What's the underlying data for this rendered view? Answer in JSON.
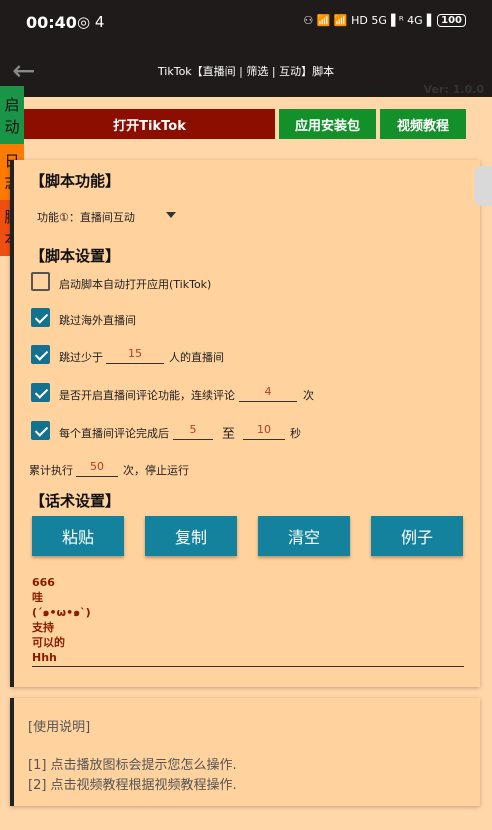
{
  "status": {
    "time": "00:40",
    "notif": "4",
    "net_icons": "⚇ 📶 📶 HD 5G▐ ᴿ 4G▐",
    "battery": "100"
  },
  "toolbar": {
    "title": "TikTok【直播间 | 筛选 | 互动】脚本"
  },
  "version": "Ver: 1.0.0",
  "sidetabs": {
    "start": "启\n动",
    "log": "日\n志",
    "script": "脚\n本"
  },
  "buttons": {
    "open": "打开TikTok",
    "install": "应用安装包",
    "video": "视频教程"
  },
  "sections": {
    "func": "【脚本功能】",
    "settings": "【脚本设置】",
    "talk": "【话术设置】"
  },
  "function": {
    "label": "功能①：直播间互动"
  },
  "settings": {
    "auto_open": "启动脚本自动打开应用(TikTok)",
    "skip_overseas": "跳过海外直播间",
    "skip_less_pre": "跳过少于",
    "skip_less_val": "15",
    "skip_less_post": "人的直播间",
    "comment_pre": "是否开启直播间评论功能，连续评论",
    "comment_val": "4",
    "comment_post": "次",
    "after_pre": "每个直播间评论完成后",
    "after_min": "5",
    "after_to": "至",
    "after_max": "10",
    "after_unit": "秒",
    "total_pre": "累计执行",
    "total_val": "50",
    "total_post": "次，停止运行"
  },
  "actions": {
    "paste": "粘贴",
    "copy": "复制",
    "clear": "清空",
    "example": "例子"
  },
  "script_text": "666\n哇\n(´๑•ω•๑`)\n支持\n可以的\nHhh",
  "help": {
    "title": "[使用说明]",
    "line1": "[1] 点击播放图标会提示您怎么操作.",
    "line2": "[2] 点击视频教程根据视频教程操作."
  }
}
